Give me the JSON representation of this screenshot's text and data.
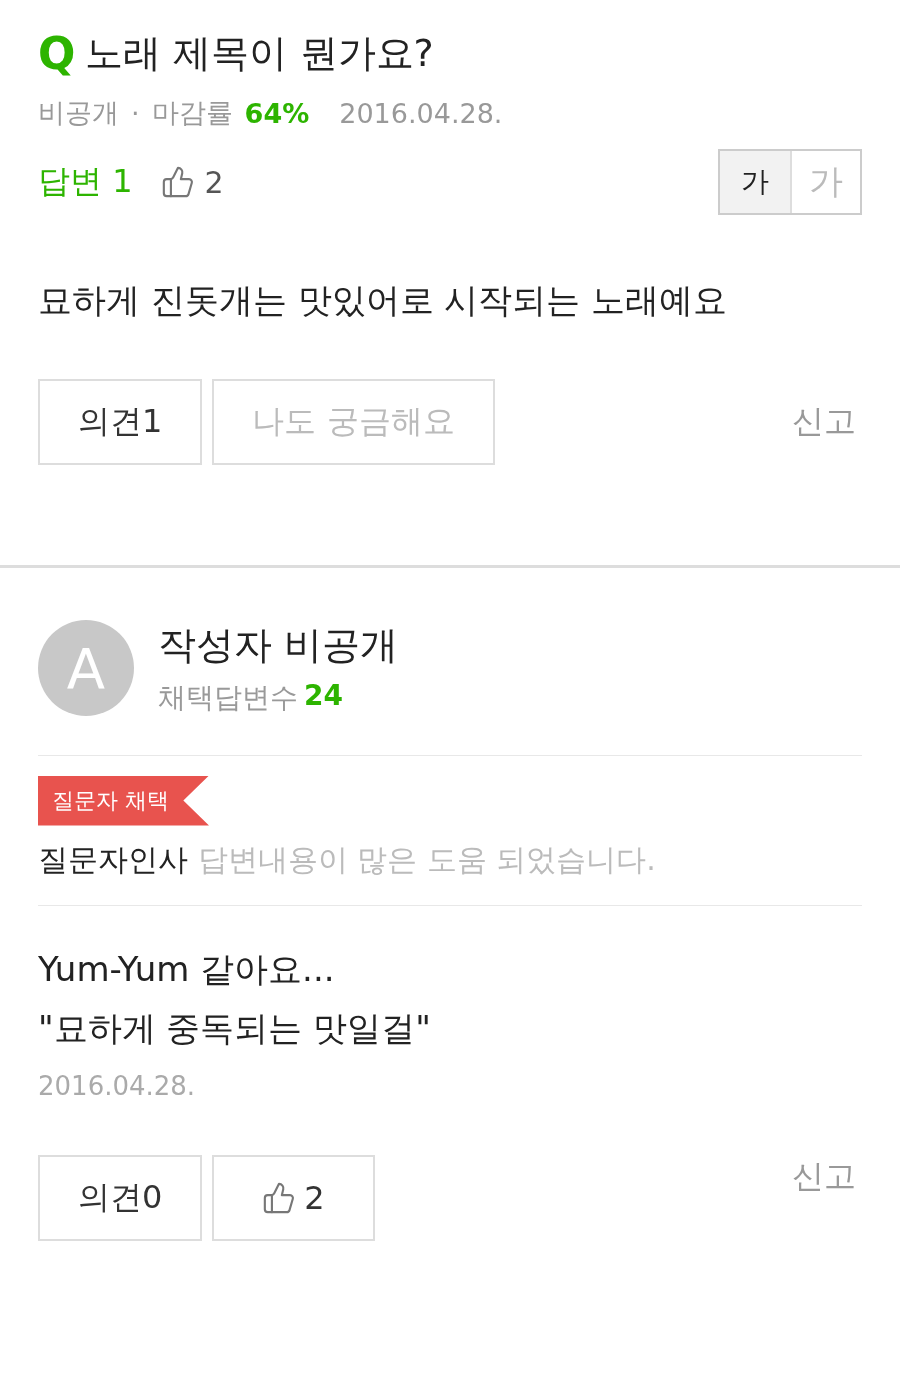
{
  "question": {
    "mark": "Q",
    "title": "노래 제목이 뭔가요?",
    "visibility": "비공개",
    "separator": "·",
    "close_rate_label": "마감률",
    "close_rate": "64%",
    "date": "2016.04.28.",
    "answers_label": "답변 1",
    "likes": "2",
    "font_size_options": [
      {
        "label": "가",
        "selected": true
      },
      {
        "label": "가",
        "selected": false
      }
    ],
    "body": "묘하게 진돗개는 맛있어로 시작되는 노래예요",
    "buttons": [
      {
        "label": "의견1",
        "disabled": false
      },
      {
        "label": "나도 궁금해요",
        "disabled": true
      }
    ],
    "report": "신고"
  },
  "answer": {
    "avatar_letter": "A",
    "author": "작성자 비공개",
    "adopted_count_label": "채택답변수",
    "adopted_count": "24",
    "badge": "질문자 채택",
    "greeting_label": "질문자인사",
    "greeting": "답변내용이 많은 도움 되었습니다.",
    "body_lines": [
      "Yum-Yum 같아요...",
      "\"묘하게 중독되는 맛일걸\""
    ],
    "date": "2016.04.28.",
    "comment_button": "의견0",
    "likes": "2",
    "report": "신고"
  }
}
